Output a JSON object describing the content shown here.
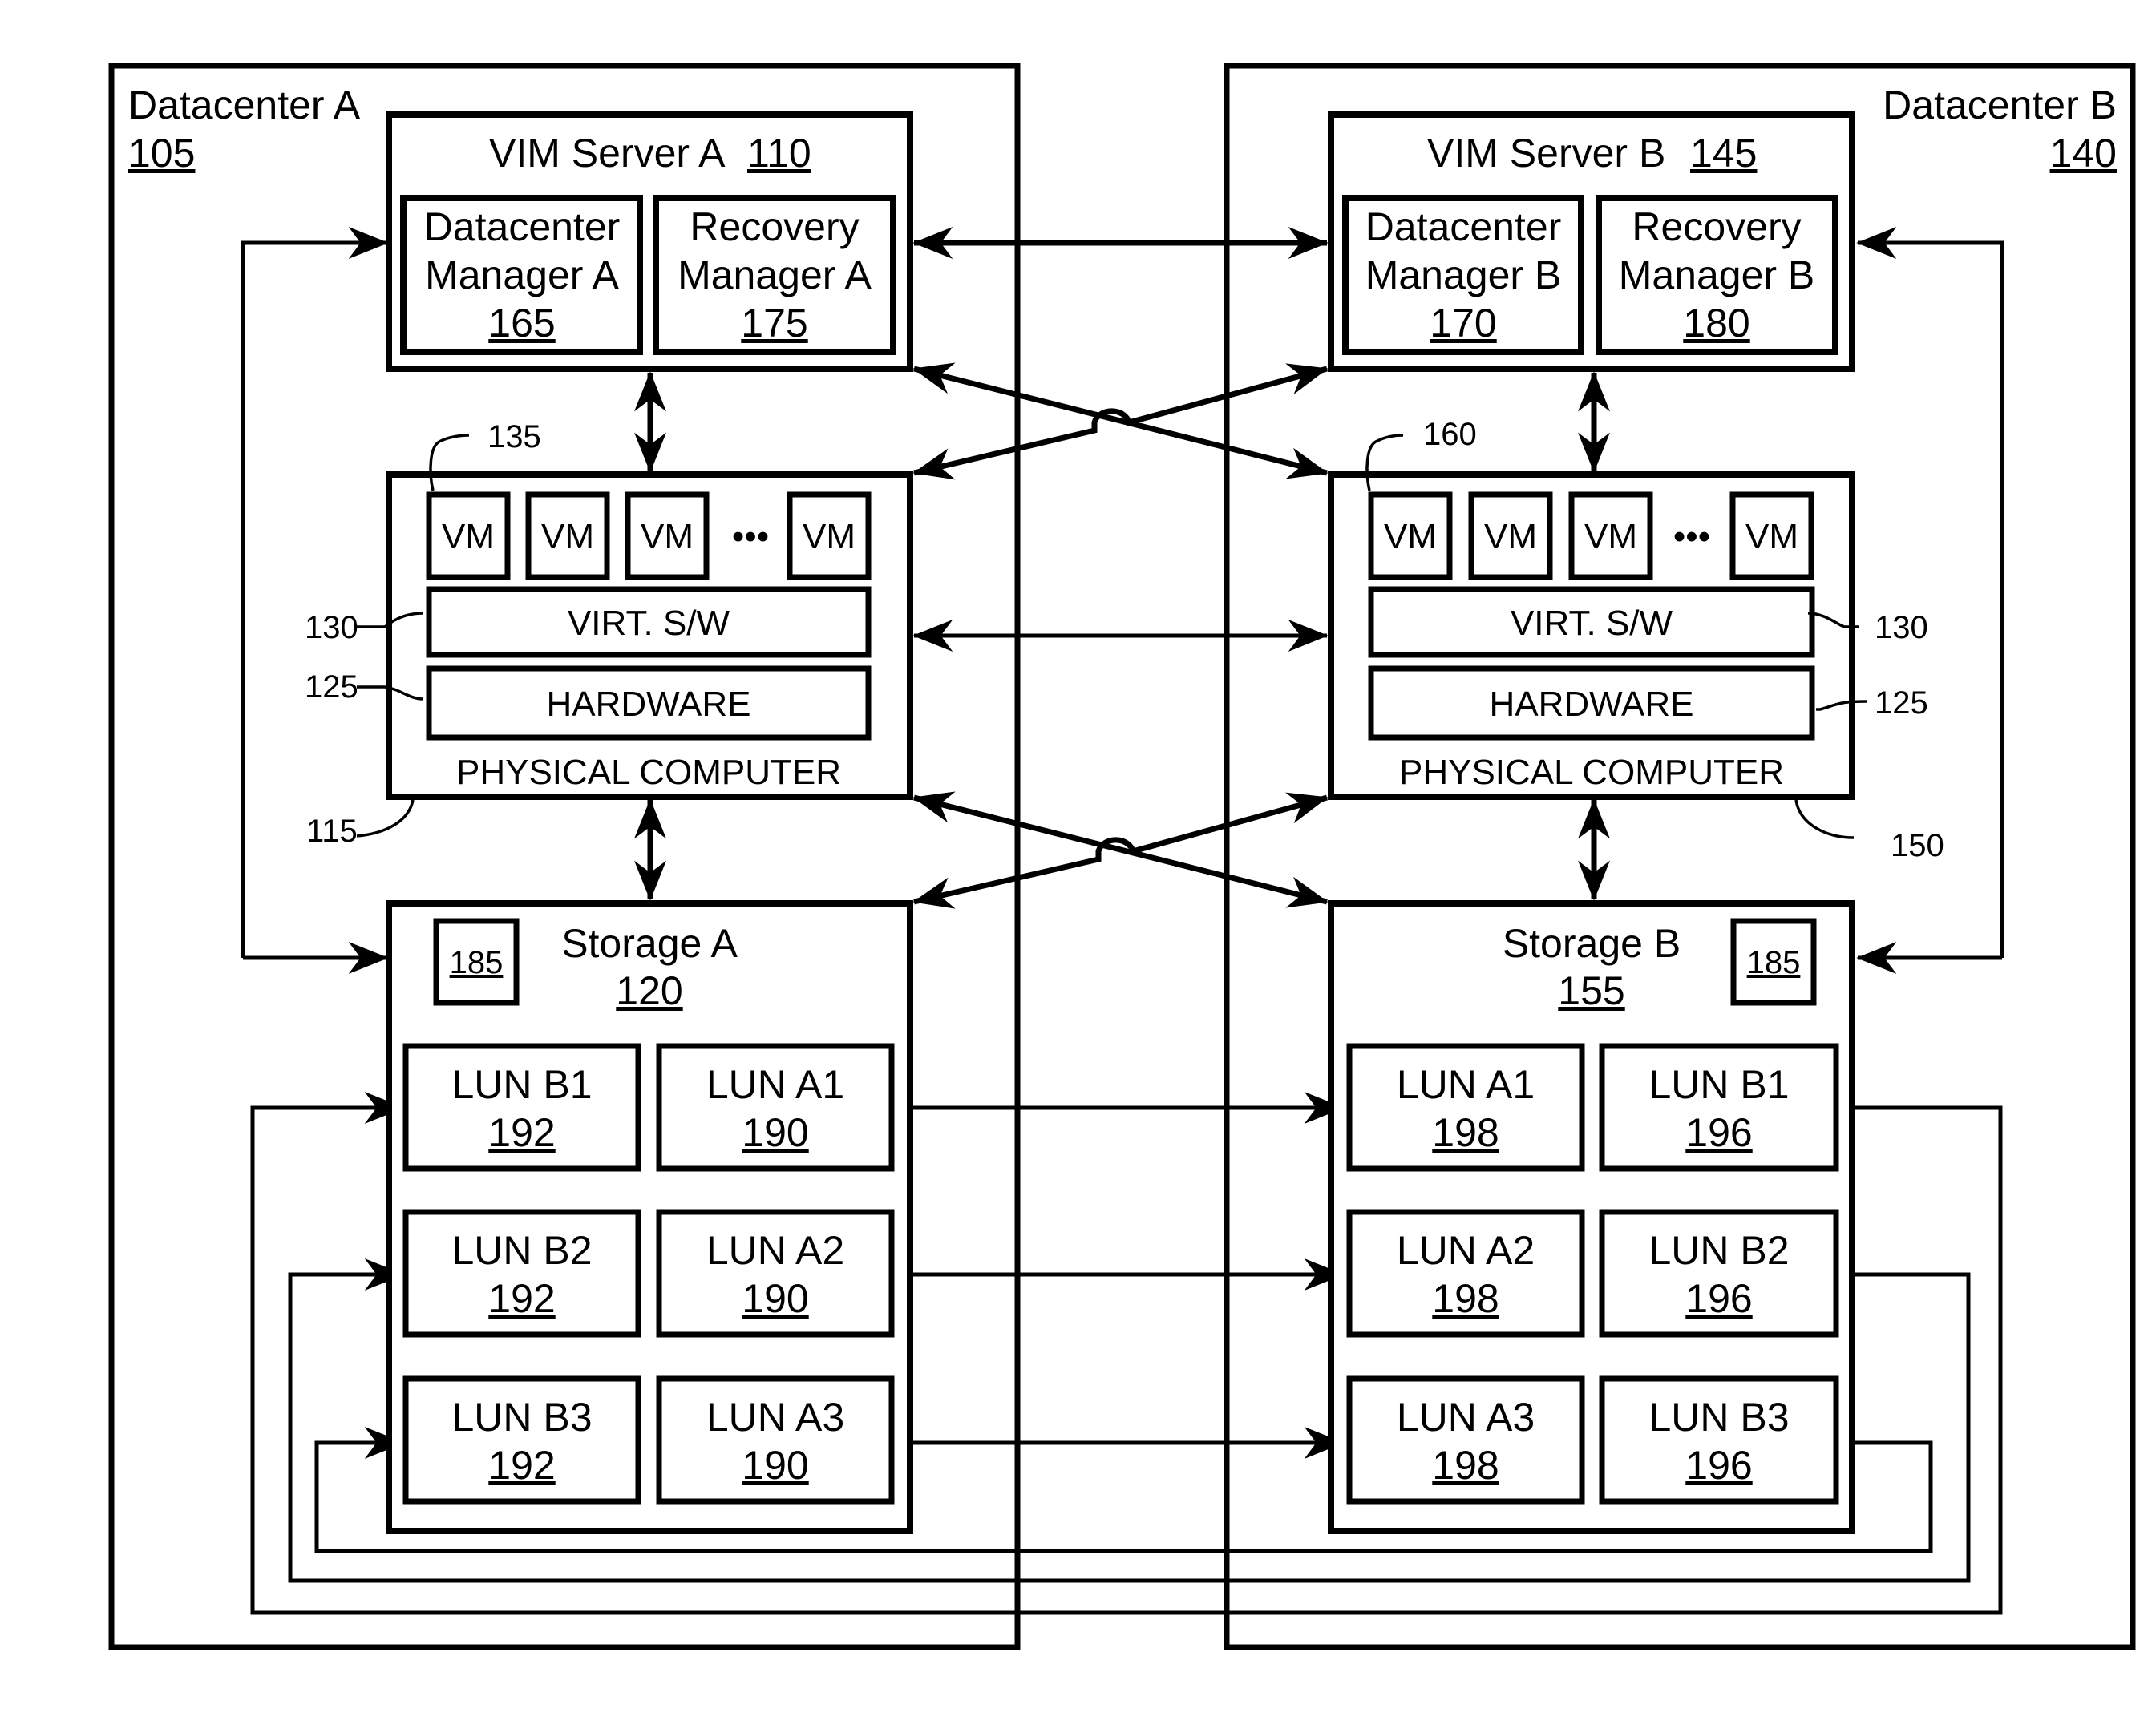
{
  "datacenter_a": {
    "label": "Datacenter A",
    "ref": "105",
    "vim_server": {
      "label": "VIM Server A",
      "ref": "110",
      "datacenter_manager": {
        "line1": "Datacenter",
        "line2": "Manager A",
        "ref": "165"
      },
      "recovery_manager": {
        "line1": "Recovery",
        "line2": "Manager A",
        "ref": "175"
      }
    },
    "physical_computer": {
      "label": "PHYSICAL COMPUTER",
      "ref": "115",
      "vm_label": "VM",
      "vm_ref": "135",
      "ellipsis": "•••",
      "virt_sw": "VIRT. S/W",
      "virt_ref": "130",
      "hardware": "HARDWARE",
      "hardware_ref": "125"
    },
    "storage": {
      "label": "Storage A",
      "ref": "120",
      "marker_ref": "185",
      "luns": [
        {
          "name": "LUN B1",
          "ref": "192"
        },
        {
          "name": "LUN A1",
          "ref": "190"
        },
        {
          "name": "LUN B2",
          "ref": "192"
        },
        {
          "name": "LUN A2",
          "ref": "190"
        },
        {
          "name": "LUN B3",
          "ref": "192"
        },
        {
          "name": "LUN A3",
          "ref": "190"
        }
      ]
    }
  },
  "datacenter_b": {
    "label": "Datacenter B",
    "ref": "140",
    "vim_server": {
      "label": "VIM Server B",
      "ref": "145",
      "datacenter_manager": {
        "line1": "Datacenter",
        "line2": "Manager B",
        "ref": "170"
      },
      "recovery_manager": {
        "line1": "Recovery",
        "line2": "Manager B",
        "ref": "180"
      }
    },
    "physical_computer": {
      "label": "PHYSICAL COMPUTER",
      "ref": "150",
      "vm_label": "VM",
      "vm_ref": "160",
      "ellipsis": "•••",
      "virt_sw": "VIRT. S/W",
      "virt_ref": "130",
      "hardware": "HARDWARE",
      "hardware_ref": "125"
    },
    "storage": {
      "label": "Storage B",
      "ref": "155",
      "marker_ref": "185",
      "luns": [
        {
          "name": "LUN A1",
          "ref": "198"
        },
        {
          "name": "LUN B1",
          "ref": "196"
        },
        {
          "name": "LUN A2",
          "ref": "198"
        },
        {
          "name": "LUN B2",
          "ref": "196"
        },
        {
          "name": "LUN A3",
          "ref": "198"
        },
        {
          "name": "LUN B3",
          "ref": "196"
        }
      ]
    }
  }
}
